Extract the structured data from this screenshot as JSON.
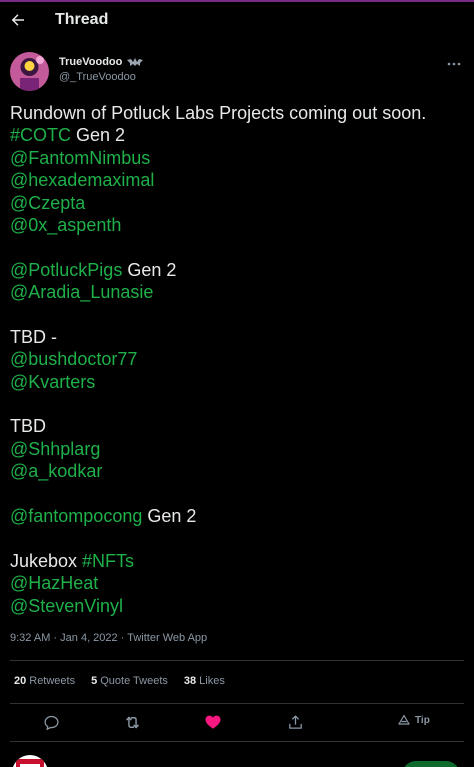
{
  "header": {
    "title": "Thread"
  },
  "author": {
    "display_name": "TrueVoodoo",
    "handle": "@_TrueVoodoo"
  },
  "tweet": {
    "lines": [
      [
        {
          "t": "Rundown of Potluck Labs Projects coming out soon.",
          "link": false
        }
      ],
      [
        {
          "t": "#COTC",
          "link": true
        },
        {
          "t": " Gen 2",
          "link": false
        }
      ],
      [
        {
          "t": "@FantomNimbus",
          "link": true
        }
      ],
      [
        {
          "t": "@hexademaximal",
          "link": true
        }
      ],
      [
        {
          "t": "@Czepta",
          "link": true
        }
      ],
      [
        {
          "t": "@0x_aspenth",
          "link": true
        }
      ],
      [],
      [
        {
          "t": "@PotluckPigs",
          "link": true
        },
        {
          "t": " Gen 2",
          "link": false
        }
      ],
      [
        {
          "t": "@Aradia_Lunasie",
          "link": true
        }
      ],
      [],
      [
        {
          "t": "TBD -",
          "link": false
        }
      ],
      [
        {
          "t": "@bushdoctor77",
          "link": true
        }
      ],
      [
        {
          "t": "@Kvarters",
          "link": true
        }
      ],
      [],
      [
        {
          "t": "TBD",
          "link": false
        }
      ],
      [
        {
          "t": "@Shhplarg",
          "link": true
        }
      ],
      [
        {
          "t": "@a_kodkar",
          "link": true
        }
      ],
      [],
      [
        {
          "t": "@fantompocong",
          "link": true
        },
        {
          "t": " Gen 2",
          "link": false
        }
      ],
      [],
      [
        {
          "t": "Jukebox ",
          "link": false
        },
        {
          "t": "#NFTs",
          "link": true
        }
      ],
      [
        {
          "t": "@HazHeat",
          "link": true
        }
      ],
      [
        {
          "t": "@StevenVinyl",
          "link": true
        }
      ]
    ],
    "time": "9:32 AM",
    "date": "Jan 4, 2022",
    "source": "Twitter Web App",
    "separator": "·"
  },
  "stats": {
    "retweets": {
      "count": "20",
      "label": "Retweets"
    },
    "quotes": {
      "count": "5",
      "label": "Quote Tweets"
    },
    "likes": {
      "count": "38",
      "label": "Likes"
    }
  },
  "actions": {
    "tip_label": "Tip",
    "liked": true
  },
  "colors": {
    "background": "#000000",
    "text": "#e7e9ea",
    "muted": "#8b98a5",
    "link": "#1fb04a",
    "like": "#f91880",
    "divider": "#2f3336"
  },
  "icons": {
    "back": "back-arrow-icon",
    "more": "more-dots-icon",
    "reply": "reply-icon",
    "retweet": "retweet-icon",
    "like": "heart-icon",
    "share": "share-icon",
    "tip": "tip-icon"
  }
}
